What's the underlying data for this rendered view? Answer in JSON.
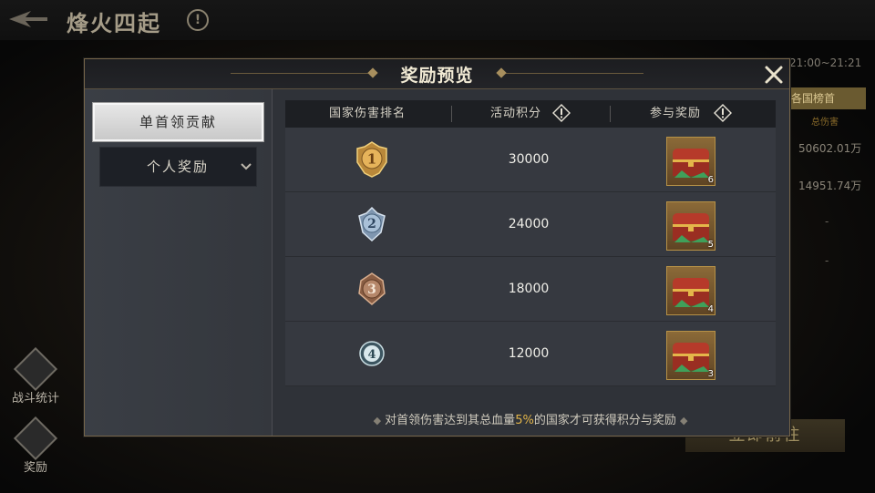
{
  "background": {
    "title": "烽火四起",
    "help_glyph": "!",
    "time_range": "21:00~21:21",
    "rank_tab": "各国榜首",
    "rank_sub": "总伤害",
    "values": [
      "50602.01万",
      "14951.74万"
    ],
    "dashes": [
      "-",
      "-"
    ],
    "goto_button": "立即前往",
    "side_buttons": {
      "stats": "战斗统计",
      "reward": "奖励"
    }
  },
  "modal": {
    "title": "奖励预览",
    "close_glyph": "✕",
    "left_tabs": {
      "main": "单首领贡献",
      "sub": "个人奖励"
    },
    "table": {
      "headers": [
        "国家伤害排名",
        "活动积分",
        "参与奖励"
      ],
      "rows": [
        {
          "rank": "1",
          "score": "30000",
          "chest_qty": "6"
        },
        {
          "rank": "2",
          "score": "24000",
          "chest_qty": "5"
        },
        {
          "rank": "3",
          "score": "18000",
          "chest_qty": "4"
        },
        {
          "rank": "4",
          "score": "12000",
          "chest_qty": "3"
        }
      ]
    },
    "footer": {
      "prefix": "对首领伤害达到其总血量",
      "highlight": "5%",
      "suffix": "的国家才可获得积分与奖励",
      "diamond": "◆"
    },
    "colors": {
      "gold": "#e4b64a",
      "silver": "#a9c0d8",
      "bronze": "#b5876a"
    }
  }
}
